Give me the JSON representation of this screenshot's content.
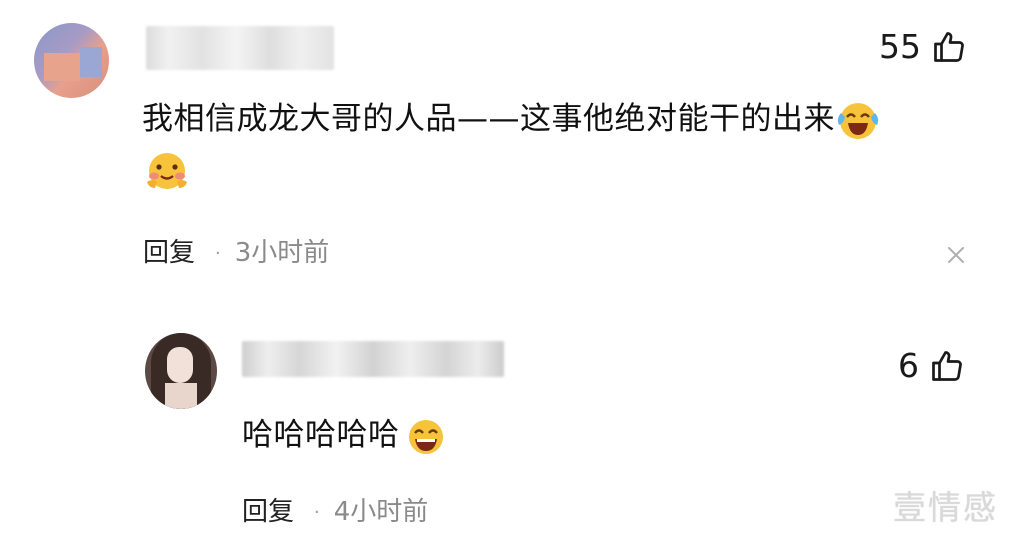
{
  "comment": {
    "likes": "55",
    "text": "我相信成龙大哥的人品——这事他绝对能干的出来",
    "reply_label": "回复",
    "separator": "·",
    "time": "3小时前"
  },
  "reply": {
    "likes": "6",
    "text": "哈哈哈哈哈",
    "reply_label": "回复",
    "separator": "·",
    "time": "4小时前"
  },
  "watermark": "壹情感",
  "icons": {
    "like": "thumbs-up-icon",
    "close": "close-icon",
    "emoji_laugh_cry": "laugh-cry-emoji",
    "emoji_blush": "blush-emoji",
    "emoji_grin": "grin-emoji"
  },
  "colors": {
    "text": "#111111",
    "meta_gray": "#8a8a8a",
    "watermark": "#d9d9d9",
    "emoji_yellow": "#f7c33b"
  }
}
